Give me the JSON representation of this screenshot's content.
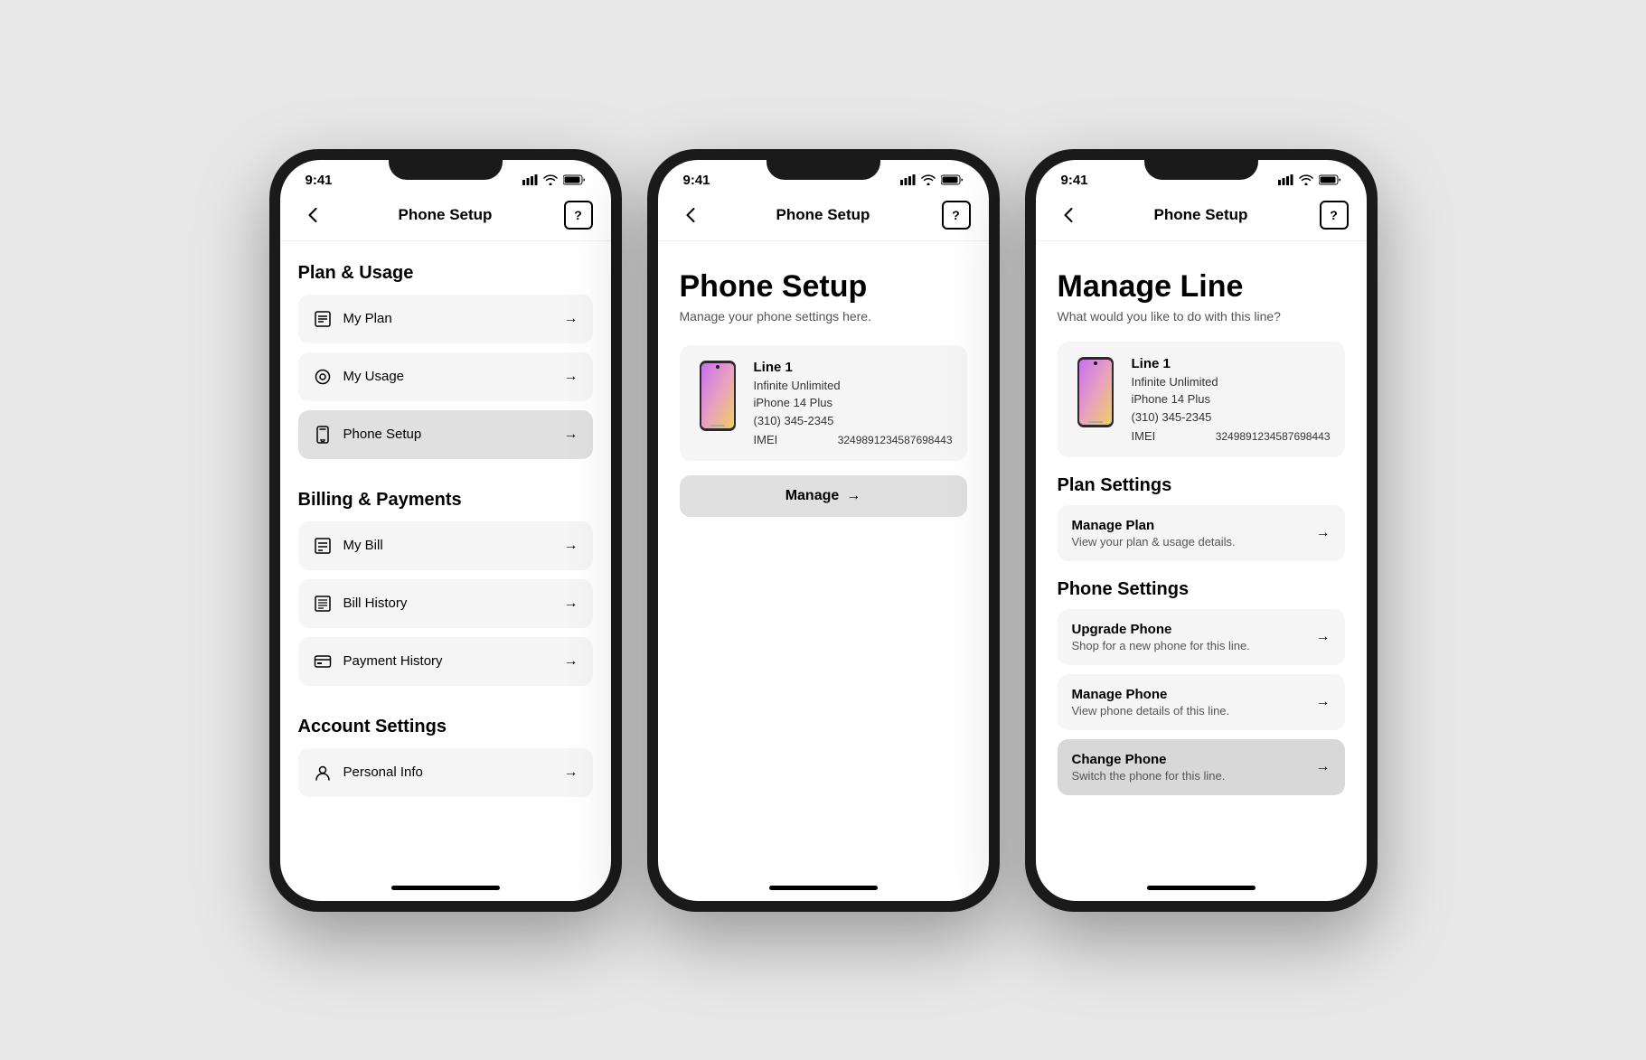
{
  "phone1": {
    "statusBar": {
      "time": "9:41"
    },
    "nav": {
      "title": "Phone Setup",
      "helpLabel": "?"
    },
    "sections": [
      {
        "id": "plan-usage",
        "header": "Plan & Usage",
        "items": [
          {
            "id": "my-plan",
            "label": "My Plan",
            "active": false
          },
          {
            "id": "my-usage",
            "label": "My Usage",
            "active": false
          },
          {
            "id": "phone-setup",
            "label": "Phone Setup",
            "active": true
          }
        ]
      },
      {
        "id": "billing-payments",
        "header": "Billing & Payments",
        "items": [
          {
            "id": "my-bill",
            "label": "My Bill",
            "active": false
          },
          {
            "id": "bill-history",
            "label": "Bill History",
            "active": false
          },
          {
            "id": "payment-history",
            "label": "Payment History",
            "active": false
          }
        ]
      },
      {
        "id": "account-settings",
        "header": "Account Settings",
        "items": [
          {
            "id": "personal-info",
            "label": "Personal Info",
            "active": false
          }
        ]
      }
    ]
  },
  "phone2": {
    "statusBar": {
      "time": "9:41"
    },
    "nav": {
      "title": "Phone Setup",
      "helpLabel": "?"
    },
    "bigTitle": "Phone Setup",
    "subtitle": "Manage your phone settings here.",
    "line": {
      "name": "Line 1",
      "plan": "Infinite Unlimited",
      "device": "iPhone 14 Plus",
      "number": "(310) 345-2345",
      "imeiLabel": "IMEI",
      "imeiValue": "3249891234587698443"
    },
    "manageBtn": "Manage"
  },
  "phone3": {
    "statusBar": {
      "time": "9:41"
    },
    "nav": {
      "title": "Phone Setup",
      "helpLabel": "?"
    },
    "bigTitle": "Manage Line",
    "subtitle": "What would you like to do with this line?",
    "line": {
      "name": "Line 1",
      "plan": "Infinite Unlimited",
      "device": "iPhone 14 Plus",
      "number": "(310) 345-2345",
      "imeiLabel": "IMEI",
      "imeiValue": "3249891234587698443"
    },
    "planSettings": {
      "title": "Plan Settings",
      "items": [
        {
          "id": "manage-plan",
          "title": "Manage Plan",
          "desc": "View your plan & usage details.",
          "active": false
        }
      ]
    },
    "phoneSettings": {
      "title": "Phone Settings",
      "items": [
        {
          "id": "upgrade-phone",
          "title": "Upgrade Phone",
          "desc": "Shop for a new phone for this line.",
          "active": false
        },
        {
          "id": "manage-phone",
          "title": "Manage Phone",
          "desc": "View phone details of this line.",
          "active": false
        },
        {
          "id": "change-phone",
          "title": "Change Phone",
          "desc": "Switch the phone for this line.",
          "active": true
        }
      ]
    }
  }
}
